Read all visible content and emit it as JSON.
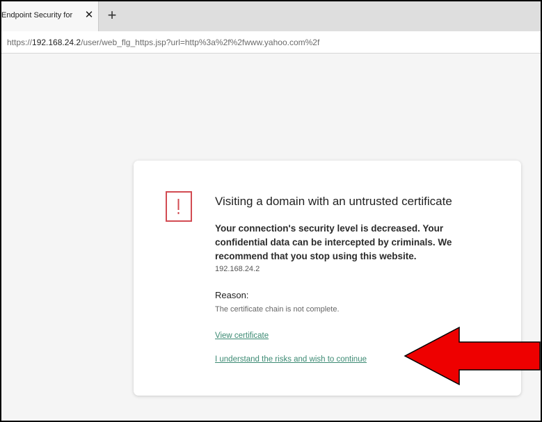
{
  "browser": {
    "tab_title": "Endpoint Security for",
    "tab_close_glyph": "✕",
    "new_tab_glyph": "+",
    "url_scheme": "https://",
    "url_host": "192.168.24.2",
    "url_rest": "/user/web_flg_https.jsp?url=http%3a%2f%2fwww.yahoo.com%2f"
  },
  "warning": {
    "icon": "exclamation-icon",
    "icon_color": "#d24b52",
    "title": "Visiting a domain with an untrusted certificate",
    "message": "Your connection's security level is decreased. Your confidential data can be intercepted by criminals. We recommend that you stop using this website.",
    "domain": "192.168.24.2",
    "reason_label": "Reason:",
    "reason_text": "The certificate chain is not complete.",
    "view_certificate_link": "View certificate",
    "continue_link": "I understand the risks and wish to continue",
    "link_color": "#3c8a73"
  },
  "annotation": {
    "arrow_icon": "red-arrow-icon",
    "arrow_color": "#ee0000"
  }
}
